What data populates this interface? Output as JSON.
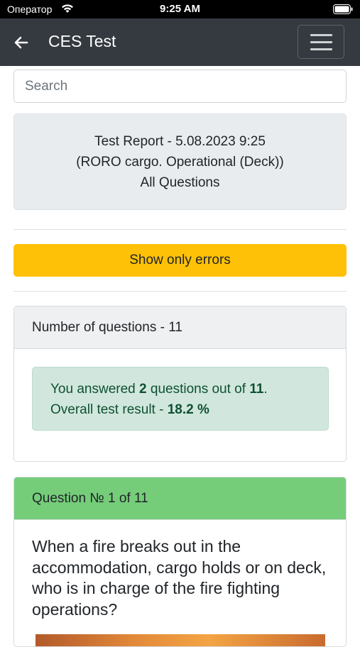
{
  "status_bar": {
    "carrier": "Оператор",
    "time": "9:25 AM"
  },
  "navbar": {
    "title": "CES Test"
  },
  "search": {
    "placeholder": "Search"
  },
  "report": {
    "line1": "Test Report - 5.08.2023 9:25",
    "line2": "(RORO cargo. Operational (Deck))",
    "line3": "All Questions"
  },
  "errors_button_label": "Show only errors",
  "summary": {
    "header": "Number of questions - 11",
    "answered_prefix": "You answered ",
    "answered_count": "2",
    "answered_middle": " questions out of ",
    "total": "11",
    "answered_suffix": ".",
    "result_prefix": "Overall test result - ",
    "result_value": "18.2 %"
  },
  "question": {
    "header": "Question № 1 of 11",
    "text": "When a fire breaks out in the accommodation, cargo holds or on deck, who is in charge of the fire fighting operations?"
  },
  "colors": {
    "navbar": "#343a40",
    "warning": "#ffc107",
    "success_header": "#75cd7a",
    "alert_bg": "#d1e7dd",
    "alert_text": "#0f5132"
  }
}
